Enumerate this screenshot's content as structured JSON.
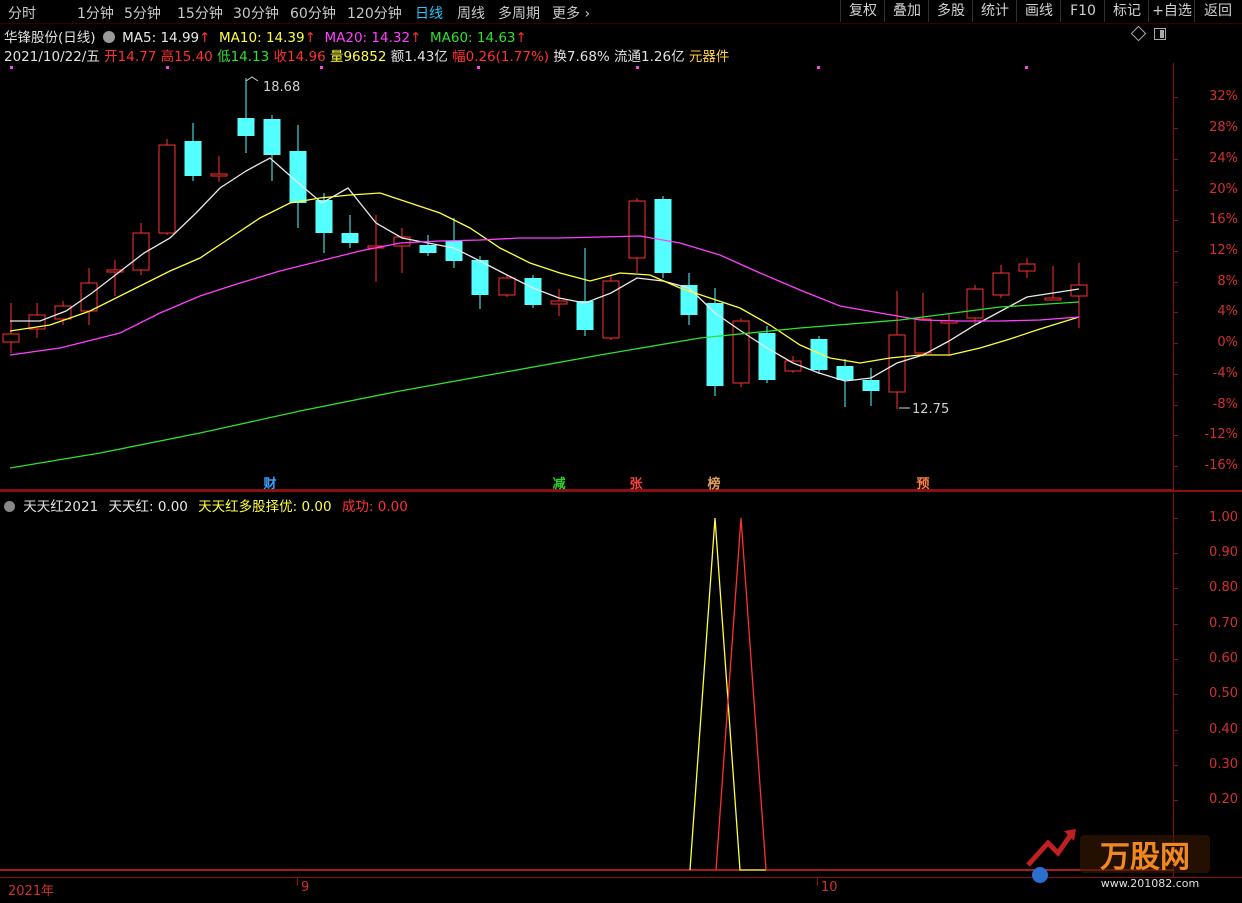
{
  "toolbar": {
    "periods": [
      "分时",
      "1分钟",
      "5分钟",
      "15分钟",
      "30分钟",
      "60分钟",
      "120分钟",
      "日线",
      "周线",
      "多周期",
      "更多"
    ],
    "active_period": "日线",
    "more_arrow": "›",
    "buttons": [
      "复权",
      "叠加",
      "多股",
      "统计",
      "画线",
      "F10",
      "标记",
      "+自选",
      "返回"
    ]
  },
  "stock": {
    "name": "华锋股份",
    "period_label": "(日线)",
    "ma": [
      {
        "label": "MA5:",
        "value": "14.99",
        "color": "#e8e8e8"
      },
      {
        "label": "MA10:",
        "value": "14.39",
        "color": "#ffff40"
      },
      {
        "label": "MA20:",
        "value": "14.32",
        "color": "#ff40ff"
      },
      {
        "label": "MA60:",
        "value": "14.63",
        "color": "#30e030"
      }
    ],
    "up_arrow": "↑",
    "date": "2021/10/22/五",
    "open_label": "开",
    "open": "14.77",
    "high_label": "高",
    "high": "15.40",
    "low_label": "低",
    "low": "14.13",
    "close_label": "收",
    "close": "14.96",
    "vol_label": "量",
    "vol": "96852",
    "amount_label": "额",
    "amount": "1.43亿",
    "chg_label": "幅",
    "chg": "0.26(1.77%)",
    "turnover_label": "换",
    "turnover": "7.68%",
    "float_label": "流通",
    "float": "1.26亿",
    "sector": "元器件",
    "hi_mark": "18.68",
    "lo_mark": "12.75"
  },
  "main_axis": [
    "32%",
    "28%",
    "24%",
    "20%",
    "16%",
    "12%",
    "8%",
    "4%",
    "0%",
    "-4%",
    "-8%",
    "-12%",
    "-16%"
  ],
  "events": [
    {
      "text": "财",
      "color": "#3aa0ff"
    },
    {
      "text": "减",
      "color": "#30d030"
    },
    {
      "text": "张",
      "color": "#ff4040"
    },
    {
      "text": "榜",
      "color": "#e0a060"
    },
    {
      "text": "预",
      "color": "#ff8040"
    }
  ],
  "indicator": {
    "name": "天天红2021",
    "l1": "天天红:",
    "v1": "0.00",
    "l2": "天天红多股择优:",
    "v2": "0.00",
    "l3": "成功:",
    "v3": "0.00"
  },
  "sub_axis": [
    "1.00",
    "0.90",
    "0.80",
    "0.70",
    "0.60",
    "0.50",
    "0.40",
    "0.30",
    "0.20"
  ],
  "date_axis": [
    "2021年",
    "9",
    "10"
  ],
  "watermark": {
    "brand": "万股网",
    "url": "www.201082.com"
  },
  "colors": {
    "up": "#ff3030",
    "down": "#54ffff",
    "ma5": "#e8e8e8",
    "ma10": "#ffff40",
    "ma20": "#ff40ff",
    "ma60": "#30e030"
  }
}
